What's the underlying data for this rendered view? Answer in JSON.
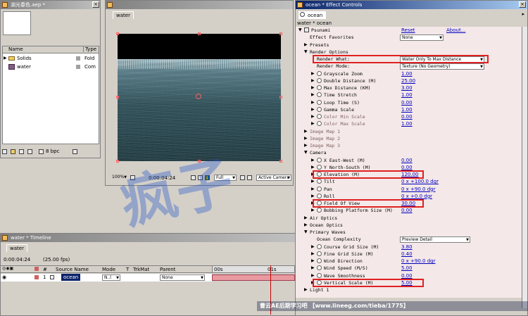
{
  "project": {
    "title": "湖光春色.aep *",
    "col_name": "Name",
    "col_type": "Type",
    "items": [
      {
        "name": "Solids",
        "type": "Fold"
      },
      {
        "name": "water",
        "type": "Com"
      }
    ],
    "bpc": "8 bpc"
  },
  "comp": {
    "tab": "water",
    "zoom": "100%",
    "timecode": "0:00:04:24",
    "resolution": "Full",
    "active_camera": "Active Camera"
  },
  "timeline": {
    "title": "water * Timeline",
    "tab": "water",
    "timecode": "0:00:04:24",
    "fps": "(25.00 fps)",
    "headers": {
      "source": "Source Name",
      "mode": "Mode",
      "t": "T",
      "trkmat": "TrkMat",
      "parent": "Parent"
    },
    "layer": {
      "num": "1",
      "name": "ocean",
      "mode": "N..l",
      "parent": "None"
    },
    "ruler": [
      "00s",
      "01s"
    ]
  },
  "effects": {
    "title": "ocean * Effect Controls",
    "tab": "ocean",
    "breadcrumb": "water * ocean",
    "rows": [
      {
        "label": "Psunami",
        "val": "Reset",
        "val2": "About...",
        "tri": "▼",
        "lvl": 0,
        "fx": true
      },
      {
        "label": "Effect Favorites",
        "dd": "None",
        "lvl": 1
      },
      {
        "label": "Presets",
        "tri": "▶",
        "lvl": 1
      },
      {
        "label": "Render Options",
        "tri": "▼",
        "lvl": 1
      },
      {
        "label": "Render What:",
        "dd": "Water Only To Max Distance",
        "lvl": 2,
        "hl": true
      },
      {
        "label": "Render Mode:",
        "dd": "Texture (No Geometry)",
        "lvl": 2
      },
      {
        "label": "Grayscale Zoom",
        "val": "1.00",
        "tri": "▶",
        "lvl": 2,
        "sw": true
      },
      {
        "label": "Double Distance (M)",
        "val": "25.00",
        "tri": "▶",
        "lvl": 2,
        "sw": true
      },
      {
        "label": "Max Distance (KM)",
        "val": "3.00",
        "tri": "▶",
        "lvl": 2,
        "sw": true
      },
      {
        "label": "Time Stretch",
        "val": "1.00",
        "tri": "▶",
        "lvl": 2,
        "sw": true
      },
      {
        "label": "Loop Time (S)",
        "val": "0.00",
        "tri": "▶",
        "lvl": 2,
        "sw": true
      },
      {
        "label": "Gamma Scale",
        "val": "1.00",
        "tri": "▶",
        "lvl": 2,
        "sw": true
      },
      {
        "label": "Color Min Scale",
        "val": "0.00",
        "tri": "▶",
        "lvl": 2,
        "sw": true,
        "muted": true
      },
      {
        "label": "Color Max Scale",
        "val": "1.00",
        "tri": "▶",
        "lvl": 2,
        "sw": true,
        "muted": true
      },
      {
        "label": "Image Map 1",
        "tri": "▶",
        "lvl": 1,
        "muted": true
      },
      {
        "label": "Image Map 2",
        "tri": "▶",
        "lvl": 1,
        "muted": true
      },
      {
        "label": "Image Map 3",
        "tri": "▶",
        "lvl": 1,
        "muted": true
      },
      {
        "label": "Camera",
        "tri": "▼",
        "lvl": 1
      },
      {
        "label": "X East-West (M)",
        "val": "0.00",
        "tri": "▶",
        "lvl": 2,
        "sw": true
      },
      {
        "label": "Y North-South (M)",
        "val": "0.00",
        "tri": "▶",
        "lvl": 2,
        "sw": true
      },
      {
        "label": "Elevation (M)",
        "val": "120.00",
        "tri": "▶",
        "lvl": 2,
        "sw": true,
        "hl": true
      },
      {
        "label": "Tilt",
        "val": "0 x +100.0 dgr",
        "tri": "▶",
        "lvl": 2,
        "sw": true
      },
      {
        "label": "Pan",
        "val": "0 x +90.0 dgr",
        "tri": "▶",
        "lvl": 2,
        "sw": true
      },
      {
        "label": "Roll",
        "val": "0 x +0.0 dgr",
        "tri": "▶",
        "lvl": 2,
        "sw": true
      },
      {
        "label": "Field Of View",
        "val": "30.00",
        "tri": "▶",
        "lvl": 2,
        "sw": true,
        "hl": true
      },
      {
        "label": "Bobbing Platform Size (M)",
        "val": "0.00",
        "tri": "▶",
        "lvl": 2,
        "sw": true
      },
      {
        "label": "Air Optics",
        "tri": "▶",
        "lvl": 1
      },
      {
        "label": "Ocean Optics",
        "tri": "▶",
        "lvl": 1
      },
      {
        "label": "Primary Waves",
        "tri": "▼",
        "lvl": 1
      },
      {
        "label": "Ocean Complexity",
        "dd": "Preview Detail",
        "lvl": 2
      },
      {
        "label": "Course Grid Size (M)",
        "val": "3.80",
        "tri": "▶",
        "lvl": 2,
        "sw": true
      },
      {
        "label": "Fine Grid Size (M)",
        "val": "0.40",
        "tri": "▶",
        "lvl": 2,
        "sw": true
      },
      {
        "label": "Wind Direction",
        "val": "0 x +90.0 dgr",
        "tri": "▶",
        "lvl": 2,
        "sw": true
      },
      {
        "label": "Wind Speed (M/S)",
        "val": "5.00",
        "tri": "▶",
        "lvl": 2,
        "sw": true
      },
      {
        "label": "Wave Smoothness",
        "val": "0.00",
        "tri": "▶",
        "lvl": 2,
        "sw": true
      },
      {
        "label": "Vertical Scale (M)",
        "val": "5.00",
        "tri": "▶",
        "lvl": 2,
        "sw": true,
        "hl": true
      },
      {
        "label": "Light 1",
        "tri": "▶",
        "lvl": 1
      }
    ]
  },
  "watermark": {
    "line": "曹云AE后期学习吧 【www.lineeg.com/tieba/1775】",
    "big": "疯子"
  }
}
